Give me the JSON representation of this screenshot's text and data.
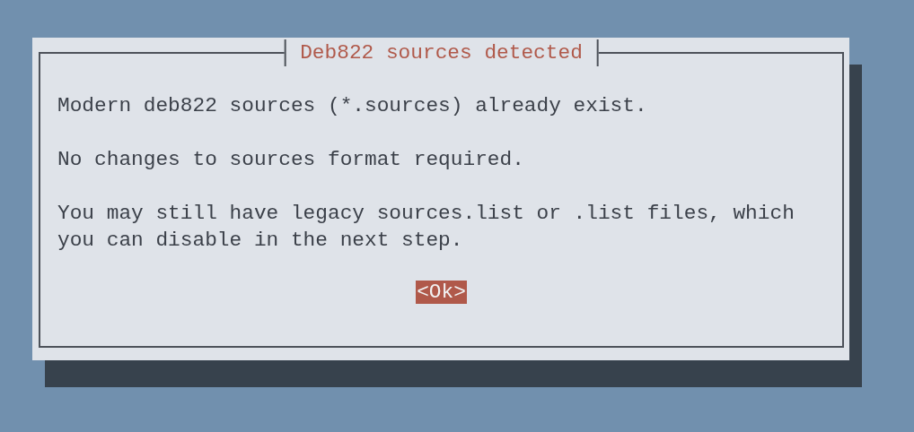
{
  "dialog": {
    "title": "Deb822 sources detected",
    "paragraphs": [
      "Modern deb822 sources (*.sources) already exist.",
      "No changes to sources format required.",
      "You may still have legacy sources.list or .list files, which you can disable in the next step."
    ],
    "buttons": [
      {
        "label": "<Ok>",
        "selected": true
      }
    ]
  }
}
